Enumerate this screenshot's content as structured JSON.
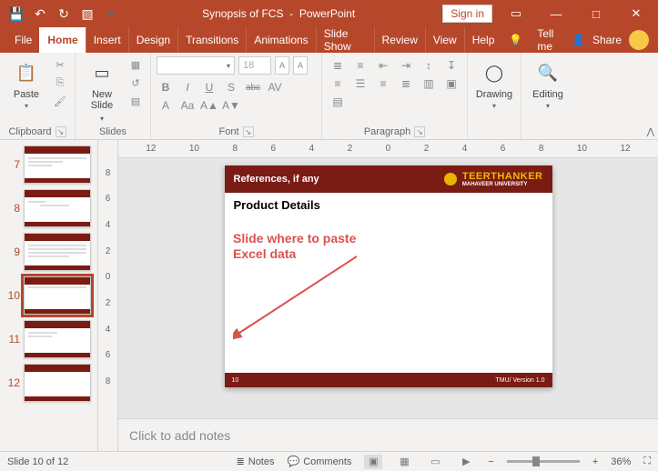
{
  "titlebar": {
    "doc": "Synopsis of FCS",
    "app": "PowerPoint",
    "signin": "Sign in"
  },
  "tabs": [
    "File",
    "Home",
    "Insert",
    "Design",
    "Transitions",
    "Animations",
    "Slide Show",
    "Review",
    "View",
    "Help"
  ],
  "tellme": "Tell me",
  "share": "Share",
  "ribbon": {
    "clipboard": {
      "label": "Clipboard",
      "paste": "Paste"
    },
    "slides": {
      "label": "Slides",
      "newslide": "New\nSlide"
    },
    "font": {
      "label": "Font",
      "size_placeholder": "18",
      "btns_row1": [
        "B",
        "I",
        "U",
        "S",
        "abc",
        "AV"
      ],
      "btns_row2": [
        "A",
        "Aa",
        "A▲",
        "A▼"
      ]
    },
    "paragraph": {
      "label": "Paragraph"
    },
    "drawing": {
      "label": "Drawing",
      "btn": "Drawing"
    },
    "editing": {
      "label": "Editing",
      "btn": "Editing"
    }
  },
  "ruler_h": [
    "12",
    "10",
    "8",
    "6",
    "4",
    "2",
    "0",
    "2",
    "4",
    "6",
    "8",
    "10",
    "12"
  ],
  "ruler_v": [
    "8",
    "6",
    "4",
    "2",
    "0",
    "2",
    "4",
    "6",
    "8"
  ],
  "thumbs": [
    {
      "n": "7"
    },
    {
      "n": "8"
    },
    {
      "n": "9"
    },
    {
      "n": "10"
    },
    {
      "n": "11"
    },
    {
      "n": "12"
    }
  ],
  "slide": {
    "header": "References, if any",
    "logo1": "TEERTHANKER",
    "logo2": "MAHAVEER UNIVERSITY",
    "title": "Product Details",
    "page": "10",
    "version": "TMU/ Version 1.0"
  },
  "annotation": "Slide where to paste Excel data",
  "notes_placeholder": "Click to add notes",
  "status": {
    "slide": "Slide 10 of 12",
    "notes": "Notes",
    "comments": "Comments",
    "zoom": "36%"
  }
}
